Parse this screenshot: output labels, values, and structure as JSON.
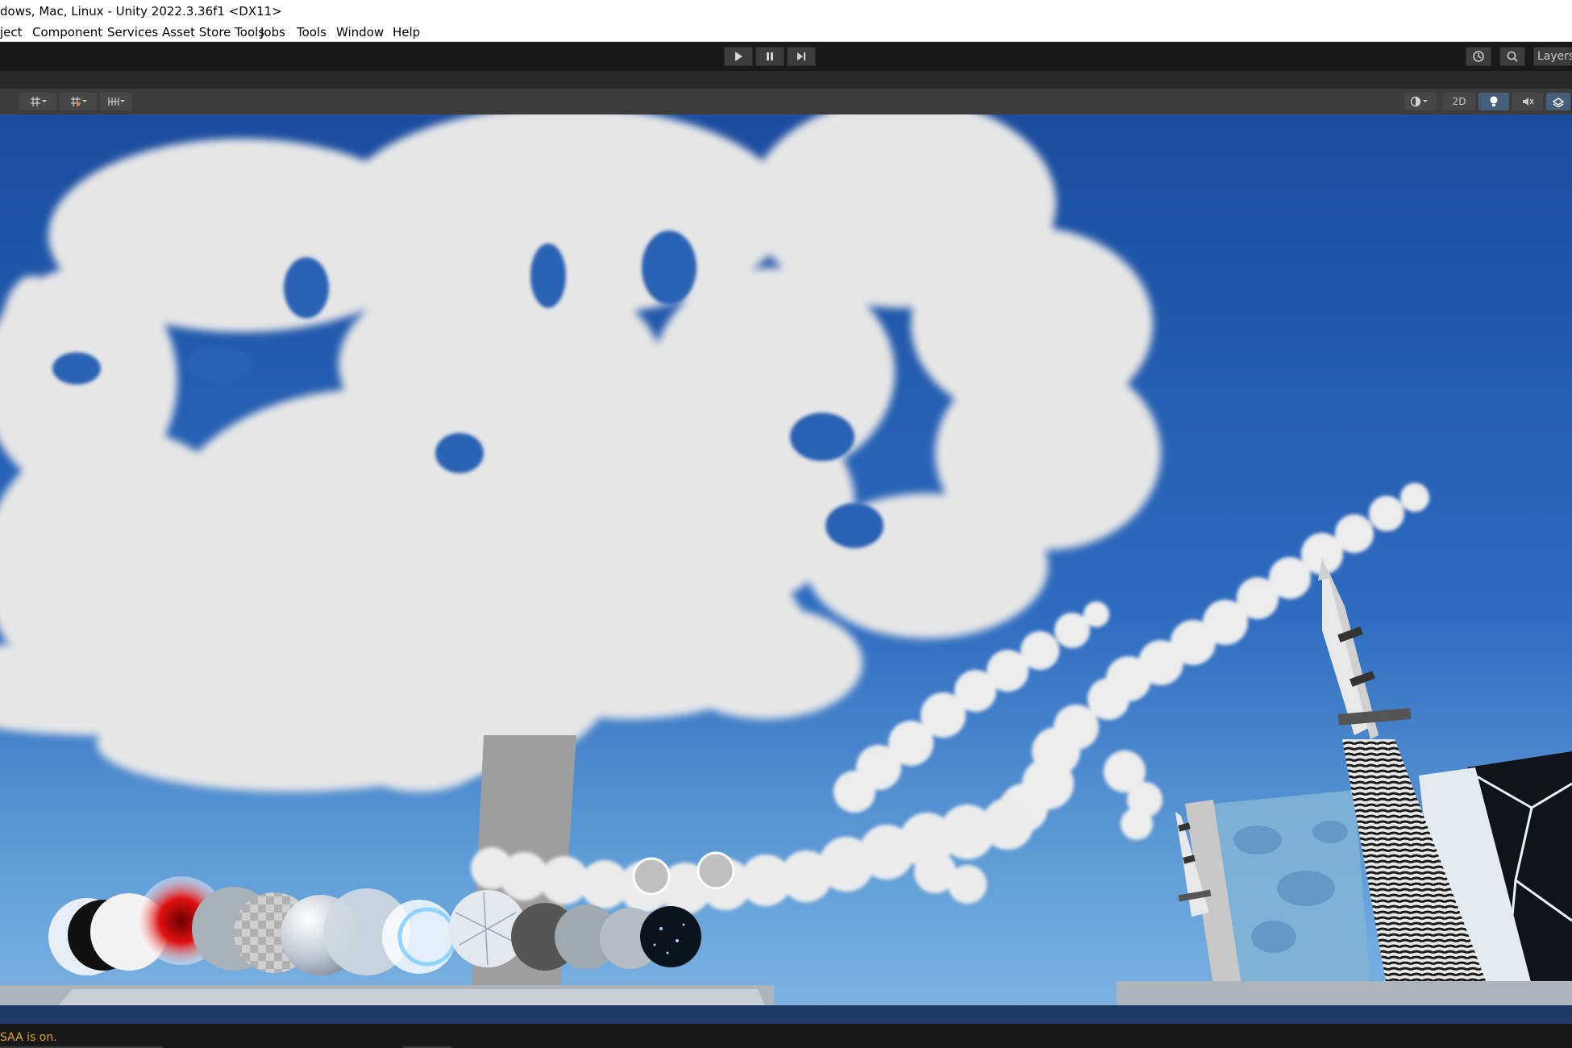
{
  "window": {
    "title": "dows, Mac, Linux - Unity 2022.3.36f1 <DX11>"
  },
  "menu": {
    "items": [
      "ject",
      "Component",
      "Services",
      "Asset Store Tools",
      "Jobs",
      "Tools",
      "Window",
      "Help"
    ]
  },
  "toolbar": {
    "play_icon": "play-icon",
    "pause_icon": "pause-icon",
    "step_icon": "step-icon",
    "history_icon": "history-icon",
    "search_icon": "search-icon",
    "layers_label": "Layers"
  },
  "scene_toolbar": {
    "mode_2d_label": "2D",
    "icons": [
      "grid-icon",
      "snap-icon",
      "increment-snap-icon",
      "draw-mode-icon",
      "lighting-icon",
      "audio-icon",
      "effects-icon"
    ]
  },
  "status": {
    "message": "SAA is on."
  },
  "colors": {
    "sky_top": "#1b4c9e",
    "sky_bottom": "#66a3d9",
    "cloud": "#e6e6e6",
    "status_text": "#d9a62c",
    "active_button": "#46607c"
  }
}
